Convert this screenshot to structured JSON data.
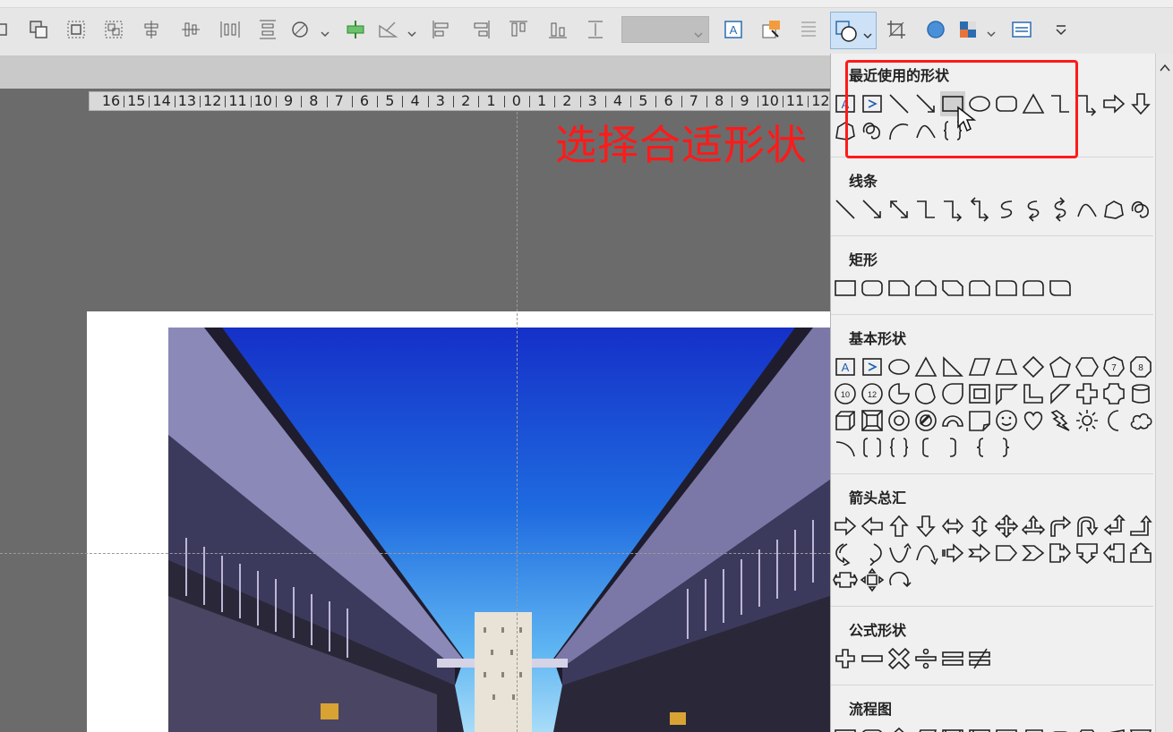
{
  "toolbar": {
    "style_combo_value": "",
    "icons": [
      "ungroup-icon",
      "bring-forward-icon",
      "group-icon",
      "ungroup-objects-icon",
      "align-center-vertical-icon",
      "align-middle-icon",
      "distribute-horizontal-icon",
      "distribute-vertical-icon",
      "combine-shapes-icon",
      "align-left-green-icon",
      "rotate-icon",
      "align-left-icon",
      "align-right-icon",
      "align-top-icon",
      "align-bottom-icon",
      "distribute-height-icon",
      "textbox-icon",
      "change-picture-icon",
      "text-direction-icon",
      "shapes-icon",
      "crop-icon",
      "fill-color-icon",
      "color-scheme-icon",
      "layout-icon",
      "more-icon"
    ]
  },
  "ruler": {
    "ticks": [
      "16",
      "15",
      "14",
      "13",
      "12",
      "11",
      "10",
      "9",
      "8",
      "7",
      "6",
      "5",
      "4",
      "3",
      "2",
      "1",
      "0",
      "1",
      "2",
      "3",
      "4",
      "5",
      "6",
      "7",
      "8",
      "9",
      "10",
      "11",
      "12"
    ]
  },
  "annotation": {
    "text": "选择合适形状",
    "color": "#ff1a1a"
  },
  "shape_panel": {
    "sections": [
      {
        "id": "recent",
        "title": "最近使用的形状",
        "count": 19
      },
      {
        "id": "lines",
        "title": "线条",
        "count": 12
      },
      {
        "id": "rectangles",
        "title": "矩形",
        "count": 9
      },
      {
        "id": "basic",
        "title": "基本形状",
        "count": 42
      },
      {
        "id": "arrows",
        "title": "箭头总汇",
        "count": 28
      },
      {
        "id": "equation",
        "title": "公式形状",
        "count": 6
      },
      {
        "id": "flowchart",
        "title": "流程图",
        "count": 12
      }
    ]
  }
}
